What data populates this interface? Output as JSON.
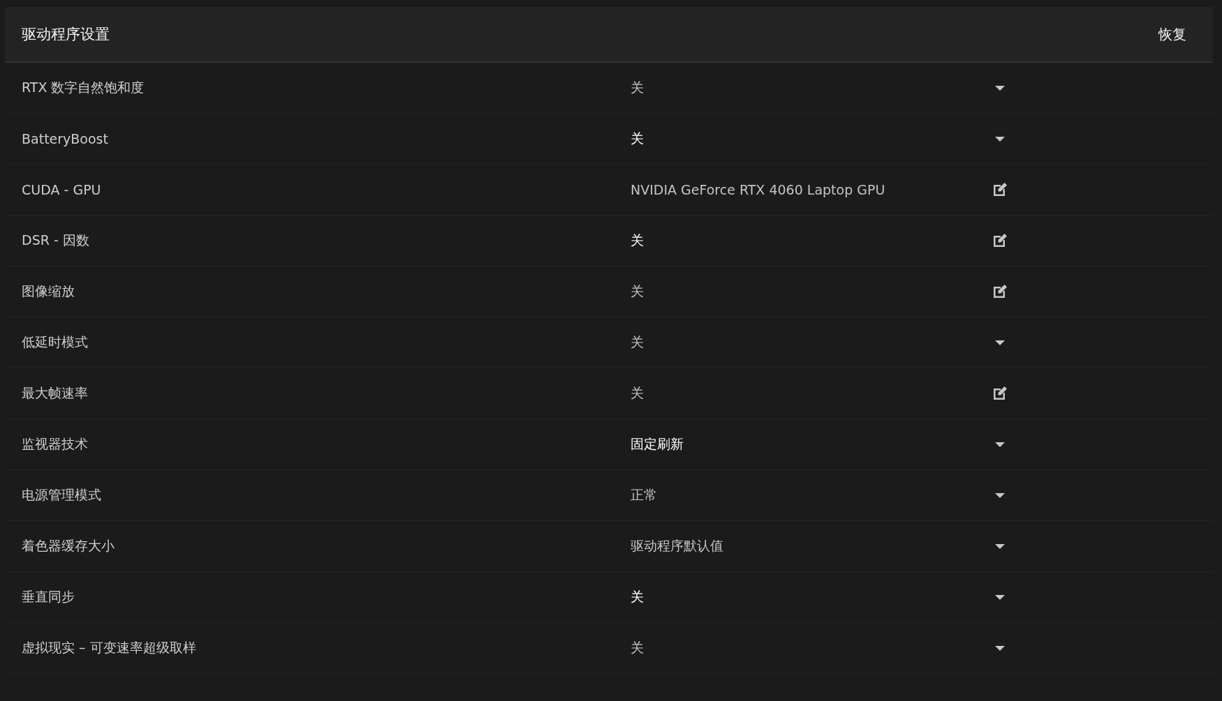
{
  "panel": {
    "title": "驱动程序设置",
    "restore_button": "恢复"
  },
  "settings": [
    {
      "name": "RTX 数字自然饱和度",
      "value": "关",
      "modified": false,
      "kind": "dropdown"
    },
    {
      "name": "BatteryBoost",
      "value": "关",
      "modified": true,
      "kind": "dropdown"
    },
    {
      "name": "CUDA - GPU",
      "value": "NVIDIA GeForce RTX 4060 Laptop GPU",
      "modified": false,
      "kind": "edit"
    },
    {
      "name": "DSR - 因数",
      "value": "关",
      "modified": true,
      "kind": "edit"
    },
    {
      "name": "图像缩放",
      "value": "关",
      "modified": false,
      "kind": "edit"
    },
    {
      "name": "低延时模式",
      "value": "关",
      "modified": false,
      "kind": "dropdown"
    },
    {
      "name": "最大帧速率",
      "value": "关",
      "modified": false,
      "kind": "edit"
    },
    {
      "name": "监视器技术",
      "value": "固定刷新",
      "modified": true,
      "kind": "dropdown"
    },
    {
      "name": "电源管理模式",
      "value": "正常",
      "modified": false,
      "kind": "dropdown"
    },
    {
      "name": "着色器缓存大小",
      "value": "驱动程序默认值",
      "modified": false,
      "kind": "dropdown"
    },
    {
      "name": "垂直同步",
      "value": "关",
      "modified": true,
      "kind": "dropdown"
    },
    {
      "name": "虚拟现实 – 可变速率超级取样",
      "value": "关",
      "modified": false,
      "kind": "dropdown"
    }
  ]
}
